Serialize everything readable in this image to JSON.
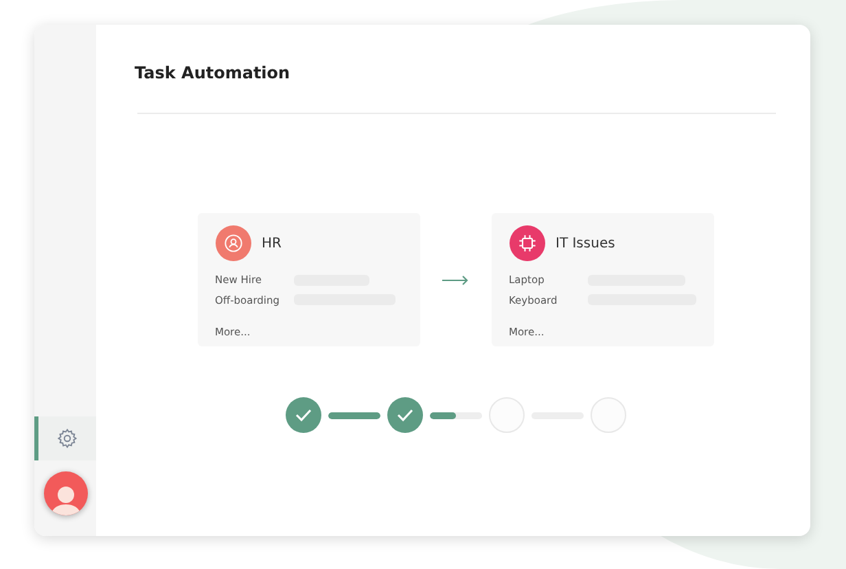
{
  "sidebar": {
    "items": [
      {
        "kind": "settings",
        "selected": true
      }
    ]
  },
  "page": {
    "title": "Task Automation"
  },
  "flow": [
    {
      "title": "HR",
      "kind": "person",
      "color": "#f07a6e",
      "rows": [
        "New Hire",
        "Off-boarding"
      ],
      "more": "More..."
    },
    {
      "title": "IT Issues",
      "kind": "chip",
      "color": "#e83a6a",
      "rows": [
        "Laptop",
        "Keyboard"
      ],
      "more": "More..."
    }
  ],
  "stepper": {
    "steps": [
      {
        "done": true
      },
      {
        "done": true
      },
      {
        "done": false
      },
      {
        "done": false
      }
    ],
    "connectors": [
      {
        "level": 1
      },
      {
        "level": 0.5
      },
      {
        "level": 0
      }
    ]
  }
}
